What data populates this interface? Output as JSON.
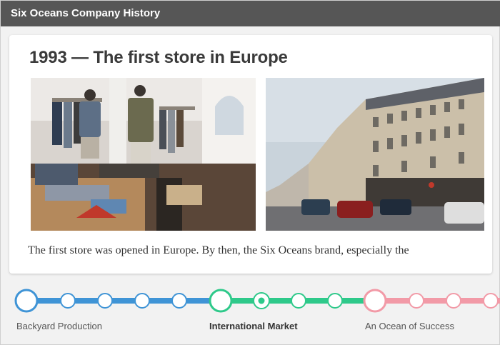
{
  "window": {
    "title": "Six Oceans Company History"
  },
  "slide": {
    "heading": "1993 — The first store in Europe",
    "body": "The first store was opened in Europe. By then, the Six Oceans brand, especially the",
    "images": [
      "store-interior-photo",
      "paris-street-photo"
    ]
  },
  "timeline": {
    "stages": [
      {
        "label": "Backyard Production",
        "color": "#3f94d6",
        "active": false
      },
      {
        "label": "International Market",
        "color": "#2ec98a",
        "active": true
      },
      {
        "label": "An Ocean of Success",
        "color": "#f29aa7",
        "active": false
      }
    ],
    "current_stage": "International Market"
  },
  "colors": {
    "titlebar": "#565656",
    "blue": "#3f94d6",
    "green": "#2ec98a",
    "pink": "#f29aa7"
  }
}
